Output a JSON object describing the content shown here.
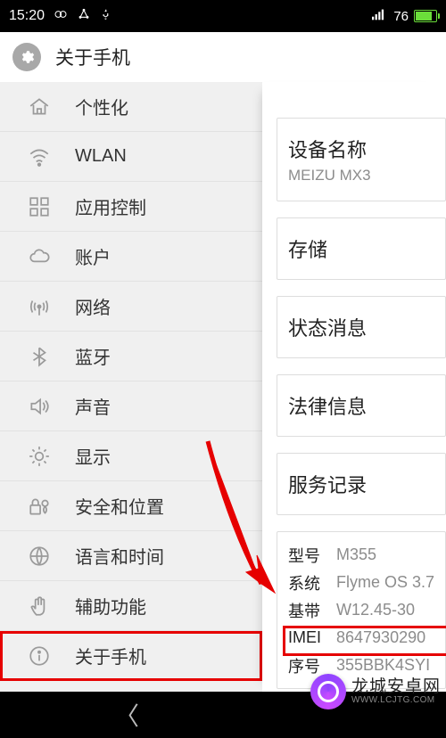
{
  "statusbar": {
    "time": "15:20",
    "battery": "76"
  },
  "header": {
    "title": "关于手机"
  },
  "sidebar": {
    "items": [
      {
        "label": "个性化"
      },
      {
        "label": "WLAN"
      },
      {
        "label": "应用控制"
      },
      {
        "label": "账户"
      },
      {
        "label": "网络"
      },
      {
        "label": "蓝牙"
      },
      {
        "label": "声音"
      },
      {
        "label": "显示"
      },
      {
        "label": "安全和位置"
      },
      {
        "label": "语言和时间"
      },
      {
        "label": "辅助功能"
      },
      {
        "label": "关于手机"
      }
    ]
  },
  "content": {
    "cards": [
      {
        "title": "设备名称",
        "sub": "MEIZU MX3"
      },
      {
        "title": "存储"
      },
      {
        "title": "状态消息"
      },
      {
        "title": "法律信息"
      },
      {
        "title": "服务记录"
      }
    ],
    "info": {
      "rows": [
        {
          "k": "型号",
          "v": "M355"
        },
        {
          "k": "系统",
          "v": "Flyme OS 3.7"
        },
        {
          "k": "基带",
          "v": "W12.45-30"
        },
        {
          "k": "IMEI",
          "v": "8647930290"
        },
        {
          "k": "序号",
          "v": "355BBK4SYI"
        }
      ]
    }
  },
  "watermark": {
    "line1": "龙城安卓网",
    "line2": "WWW.LCJTG.COM"
  }
}
